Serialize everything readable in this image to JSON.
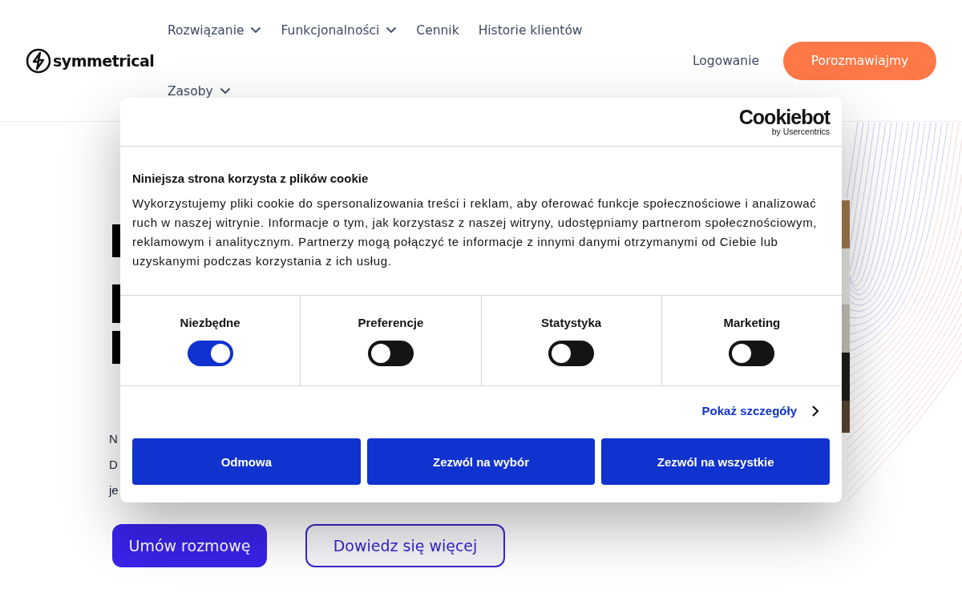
{
  "header": {
    "logo": "symmetrical",
    "nav": [
      {
        "label": "Rozwiązanie",
        "dropdown": true
      },
      {
        "label": "Funkcjonalności",
        "dropdown": true
      },
      {
        "label": "Cennik",
        "dropdown": false
      },
      {
        "label": "Historie klientów",
        "dropdown": false
      },
      {
        "label": "Zasoby",
        "dropdown": true
      }
    ],
    "login": "Logowanie",
    "cta": "Porozmawiajmy"
  },
  "hero": {
    "paragraph_fragments": [
      "N",
      "D",
      "je"
    ],
    "buttons": [
      {
        "label": "Umów rozmowę",
        "kind": "primary"
      },
      {
        "label": "Dowiedz się więcej",
        "kind": "outline"
      }
    ]
  },
  "cookie_dialog": {
    "brand": "Cookiebot",
    "brand_sub": "by Usercentrics",
    "title": "Niniejsza strona korzysta z plików cookie",
    "body": "Wykorzystujemy pliki cookie do spersonalizowania treści i reklam, aby oferować funkcje społecznościowe i analizować ruch w naszej witrynie. Informacje o tym, jak korzystasz z naszej witryny, udostępniamy partnerom społecznościowym, reklamowym i analitycznym. Partnerzy mogą połączyć te informacje z innymi danymi otrzymanymi od Ciebie lub uzyskanymi podczas korzystania z ich usług.",
    "categories": [
      {
        "label": "Niezbędne",
        "on": true
      },
      {
        "label": "Preferencje",
        "on": false
      },
      {
        "label": "Statystyka",
        "on": false
      },
      {
        "label": "Marketing",
        "on": false
      }
    ],
    "details_link": "Pokaż szczegóły",
    "buttons": [
      "Odmowa",
      "Zezwól na wybór",
      "Zezwól na wszystkie"
    ]
  }
}
